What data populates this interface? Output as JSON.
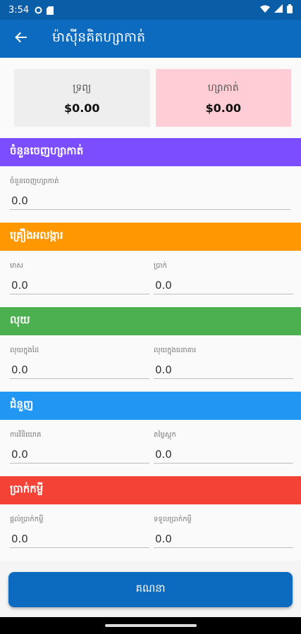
{
  "status_bar": {
    "time": "3:54"
  },
  "app_bar": {
    "title": "ម៉ាស៊ីនគិតហ្សាកាត់"
  },
  "summary": {
    "wealth_label": "ទ្រព្យ",
    "wealth_value": "$0.00",
    "zakat_label": "ហ្សាកាត់",
    "zakat_value": "$0.00"
  },
  "sections": {
    "nisab": {
      "title": "ចំនួនចេញហ្សាកាត់",
      "color": "#7c4dff",
      "field_label": "ចំនួនចេញហ្សាកាត់",
      "field_value": "0.0"
    },
    "jewelry": {
      "title": "គ្រឿងអលង្ការ",
      "color": "#ff9800",
      "gold_label": "មាស",
      "gold_value": "0.0",
      "silver_label": "ប្រាក់",
      "silver_value": "0.0"
    },
    "cash": {
      "title": "លុយ",
      "color": "#4caf50",
      "hand_label": "លុយក្នុងដៃ",
      "hand_value": "0.0",
      "bank_label": "លុយក្នុងធនាគារ",
      "bank_value": "0.0"
    },
    "business": {
      "title": "ជំនួញ",
      "color": "#2196f3",
      "investment_label": "ការវិនិយោគ",
      "investment_value": "0.0",
      "stock_label": "តម្លៃស្តុក",
      "stock_value": "0.0"
    },
    "loans": {
      "title": "ប្រាក់កម្ចី",
      "color": "#f44336",
      "given_label": "ផ្តល់ប្រាក់កម្ចី",
      "given_value": "0.0",
      "received_label": "ទទួលប្រាក់កម្ចី",
      "received_value": "0.0"
    }
  },
  "calculate_button": {
    "label": "គណនា"
  }
}
